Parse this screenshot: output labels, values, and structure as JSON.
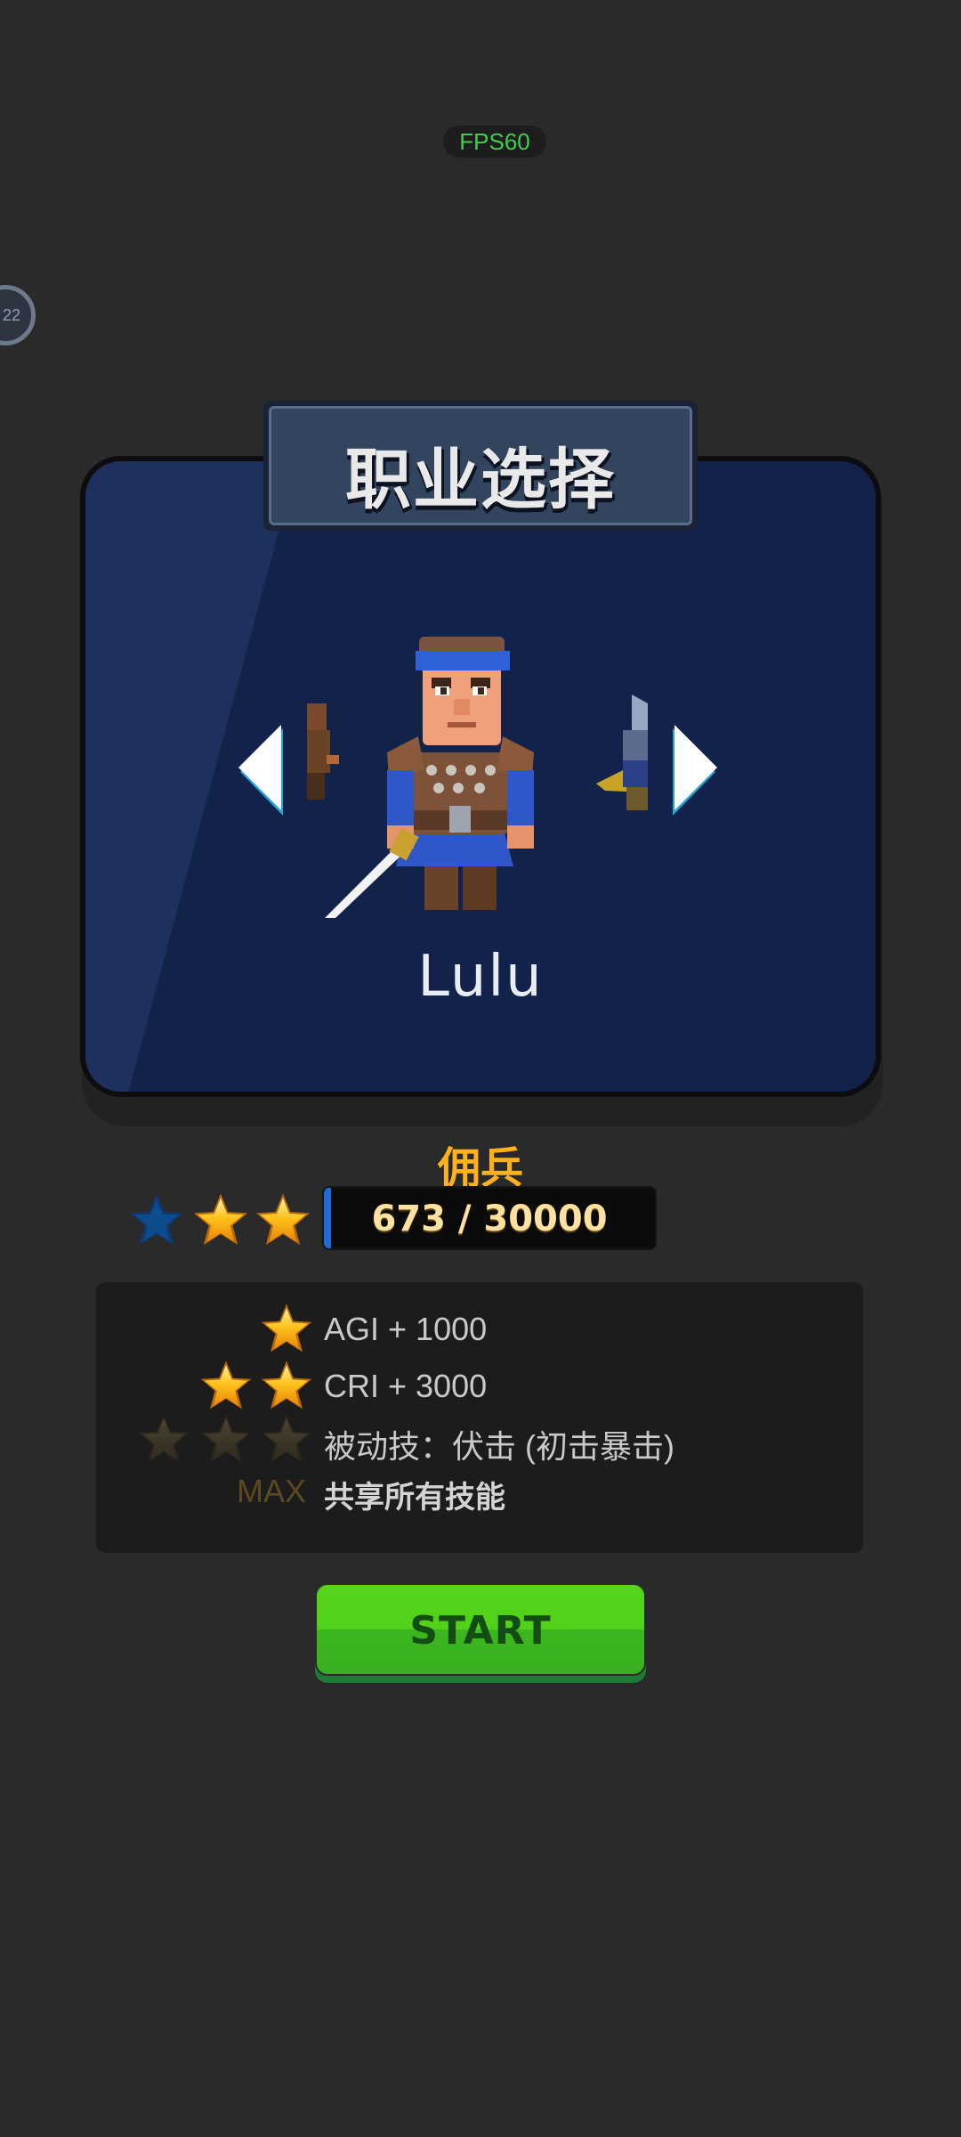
{
  "hud": {
    "fps": "FPS60",
    "side_badge": "22"
  },
  "panel": {
    "title": "职业选择"
  },
  "character": {
    "name": "Lulu",
    "class_name": "佣兵"
  },
  "stars": {
    "total": 3,
    "earned": 2
  },
  "xp": {
    "text": "673 / 30000",
    "current": 673,
    "max": 30000
  },
  "skills": [
    {
      "stars": 1,
      "text": "AGI + 1000"
    },
    {
      "stars": 2,
      "text": "CRI + 3000"
    },
    {
      "stars": 3,
      "text": "被动技：伏击 (初击暴击)"
    },
    {
      "label": "MAX",
      "text": "共享所有技能"
    }
  ],
  "start_button": {
    "label": "START"
  },
  "colors": {
    "accent": "#ffb21c",
    "panel": "#12224a",
    "start": "#52d11a",
    "fps": "#3ecf4a"
  },
  "icons": [
    "prev-arrow-icon",
    "next-arrow-icon",
    "star-icon"
  ]
}
